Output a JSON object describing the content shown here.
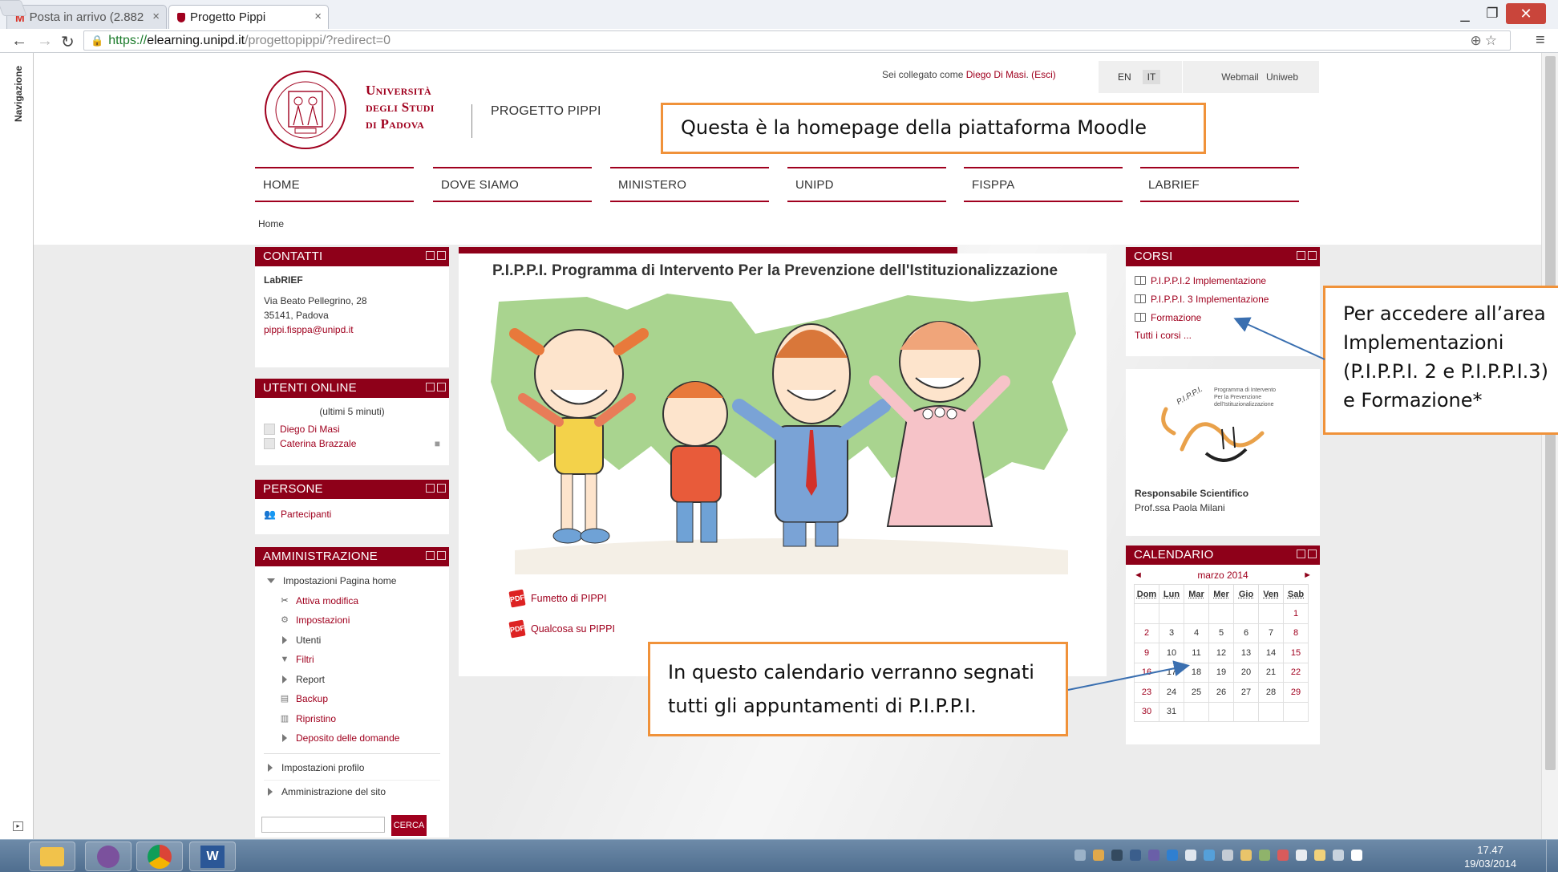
{
  "browser": {
    "tabs": [
      {
        "label": "Posta in arrivo (2.882",
        "icon": "gmail-icon"
      },
      {
        "label": "Progetto Pippi",
        "icon": "moodle-shield-icon"
      }
    ],
    "url": {
      "scheme": "https://",
      "host": "elearning.unipd.it",
      "path": "/progettopippi/?redirect=0"
    }
  },
  "navstrip_label": "Navigazione",
  "header": {
    "university": [
      "Università",
      "degli Studi",
      "di Padova"
    ],
    "project": "PROGETTO PIPPI",
    "login_prefix": "Sei collegato come",
    "login_user": "Diego Di Masi",
    "logout": "(Esci)",
    "lang_en": "EN",
    "lang_it": "IT",
    "links": "Webmail Uniweb"
  },
  "nav": [
    "HOME",
    "DOVE SIAMO",
    "MINISTERO",
    "UNIPD",
    "FISPPA",
    "LABRIEF"
  ],
  "breadcrumb": "Home",
  "contatti": {
    "title": "CONTATTI",
    "name": "LabRIEF",
    "address1": "Via Beato Pellegrino, 28",
    "address2": "35141, Padova",
    "email": "pippi.fisppa@unipd.it"
  },
  "utenti": {
    "title": "UTENTI ONLINE",
    "subtitle": "(ultimi 5 minuti)",
    "users": [
      "Diego Di Masi",
      "Caterina Brazzale"
    ]
  },
  "persone": {
    "title": "PERSONE",
    "item": "Partecipanti"
  },
  "admin": {
    "title": "AMMINISTRAZIONE",
    "home_settings": "Impostazioni Pagina home",
    "items": [
      "Attiva modifica",
      "Impostazioni",
      "Utenti",
      "Filtri",
      "Report",
      "Backup",
      "Ripristino",
      "Deposito delle domande"
    ],
    "profile": "Impostazioni profilo",
    "site": "Amministrazione del sito",
    "search_button": "CERCA"
  },
  "main": {
    "title": "P.I.P.P.I. Programma di Intervento Per la Prevenzione dell'Istituzionalizzazione",
    "links": [
      "Fumetto di PIPPI",
      "Qualcosa su PIPPI"
    ]
  },
  "corsi": {
    "title": "CORSI",
    "courses": [
      "P.I.P.P.I.2 Implementazione",
      "P.I.P.P.I. 3 Implementazione",
      "Formazione"
    ],
    "all": "Tutti i corsi ..."
  },
  "logo_block": {
    "logo_text": [
      "Programma di Intervento",
      "Per la Prevenzione",
      "dell'Istituzionalizzazione"
    ],
    "logo_word": "P.I.P.P.I.",
    "responsabile": "Responsabile Scientifico",
    "person": "Prof.ssa Paola Milani"
  },
  "calendar": {
    "title": "CALENDARIO",
    "month": "marzo 2014",
    "days": [
      "Dom",
      "Lun",
      "Mar",
      "Mer",
      "Gio",
      "Ven",
      "Sab"
    ],
    "weeks": [
      [
        "",
        "",
        "",
        "",
        "",
        "",
        "1"
      ],
      [
        "2",
        "3",
        "4",
        "5",
        "6",
        "7",
        "8"
      ],
      [
        "9",
        "10",
        "11",
        "12",
        "13",
        "14",
        "15"
      ],
      [
        "16",
        "17",
        "18",
        "19",
        "20",
        "21",
        "22"
      ],
      [
        "23",
        "24",
        "25",
        "26",
        "27",
        "28",
        "29"
      ],
      [
        "30",
        "31",
        "",
        "",
        "",
        "",
        ""
      ]
    ]
  },
  "annotations": {
    "homepage": "Questa è la homepage della piattaforma Moodle",
    "courses": [
      "Per accedere all’area",
      "Implementazioni",
      "(P.I.P.P.I. 2 e P.I.P.P.I.3)",
      "e Formazione*"
    ],
    "calendar": [
      "In questo calendario verranno segnati",
      "tutti gli appuntamenti di P.I.P.P.I."
    ]
  },
  "taskbar": {
    "time": "17.47",
    "date": "19/03/2014"
  },
  "colors": {
    "brand": "#8e0019",
    "callout_border": "#f0923a",
    "link": "#a0001e"
  }
}
